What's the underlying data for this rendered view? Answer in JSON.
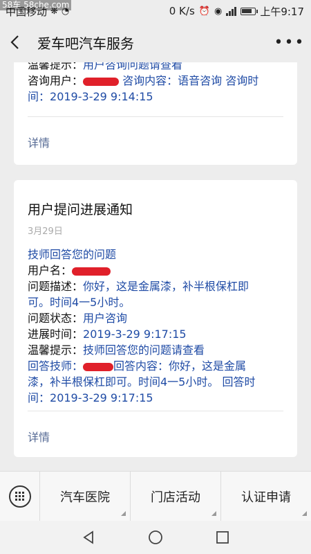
{
  "status_bar": {
    "carrier": "中国移动",
    "network_speed": "0 K/s",
    "time": "上午9:17",
    "watermark": "58车 58che.com"
  },
  "header": {
    "title": "爱车吧汽车服务"
  },
  "card1": {
    "fields": [
      {
        "label": "温馨提示：",
        "value": "用户咨询问题请查看"
      },
      {
        "label": "咨询用户：",
        "value": "",
        "redacted": true
      },
      {
        "label": "咨询内容：",
        "value": "语音咨询"
      },
      {
        "label": "咨询时间：",
        "value": "2019-3-29 9:14:15"
      }
    ],
    "line1_label": "温馨提示：",
    "line1_value": "用户咨询问题请查看",
    "line2_label": "咨询用户：",
    "line2_label_b": "咨询内容：",
    "line2_value_b": "语音咨询",
    "line2_label_c": "咨询时",
    "line3_label": "间：",
    "line3_value": "2019-3-29 9:14:15",
    "details": "详情"
  },
  "card2": {
    "title": "用户提问进展通知",
    "date": "3月29日",
    "intro": "技师回答您的问题",
    "user_label": "用户名：",
    "desc_label": "问题描述：",
    "desc_value_1": "你好，这是金属漆，补半根保杠即",
    "desc_value_2": "可。时间4一5小时。",
    "status_label": "问题状态：",
    "status_value": "用户咨询",
    "progress_label": "进展时间：",
    "progress_value": "2019-3-29 9:17:15",
    "tip_label": "温馨提示：",
    "tip_value": "技师回答您的问题请查看",
    "tech_label": "回答技师：",
    "answer_label": "回答内容：",
    "answer_value_1": "你好，这是金属",
    "answer_value_2": "漆，补半根保杠即可。时间4一5小时。",
    "answer_time_label": "回答时",
    "answer_time_label_2": "间：",
    "answer_time_value": "2019-3-29 9:17:15",
    "details": "详情"
  },
  "menu": {
    "items": [
      "汽车医院",
      "门店活动",
      "认证申请"
    ]
  },
  "colors": {
    "link_blue": "#1f4ba5",
    "details_blue": "#576b95",
    "redaction_red": "#e0202a",
    "background": "#ededed"
  },
  "icons": [
    "back-arrow-icon",
    "more-dots-icon",
    "keyboard-icon",
    "nav-back-icon",
    "nav-home-icon",
    "nav-recent-icon"
  ]
}
